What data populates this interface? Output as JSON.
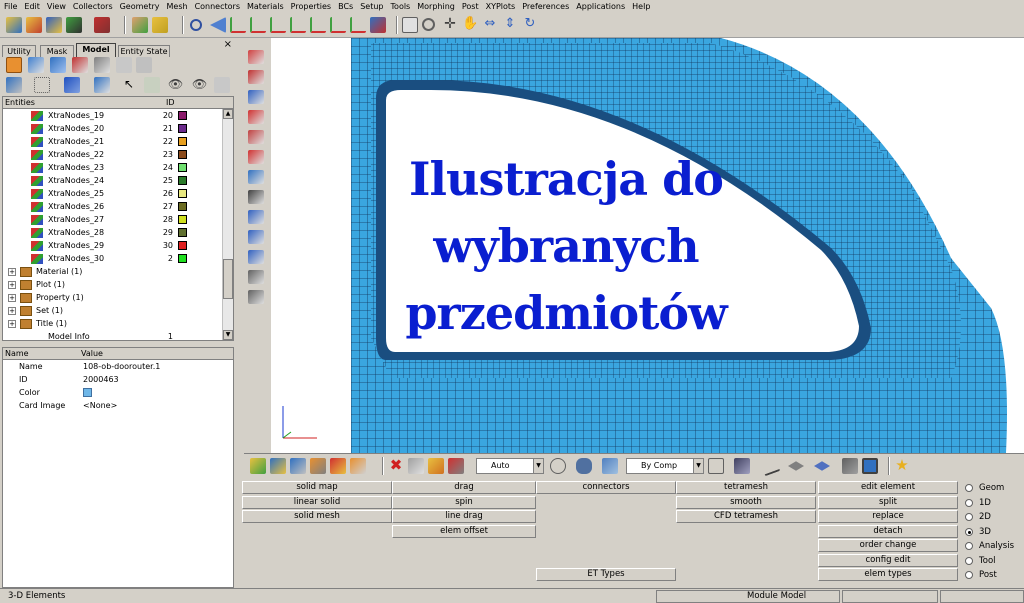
{
  "menu": [
    "File",
    "Edit",
    "View",
    "Collectors",
    "Geometry",
    "Mesh",
    "Connectors",
    "Materials",
    "Properties",
    "BCs",
    "Setup",
    "Tools",
    "Morphing",
    "Post",
    "XYPlots",
    "Preferences",
    "Applications",
    "Help"
  ],
  "tabs": [
    "Utility",
    "Mask",
    "Model",
    "Entity State"
  ],
  "active_tab": "Model",
  "tree": {
    "col_entities": "Entities",
    "col_id": "ID",
    "nodes": [
      {
        "name": "XtraNodes_19",
        "id": "20",
        "color": "#8b1a6b"
      },
      {
        "name": "XtraNodes_20",
        "id": "21",
        "color": "#6b2a8b"
      },
      {
        "name": "XtraNodes_21",
        "id": "22",
        "color": "#e8a020"
      },
      {
        "name": "XtraNodes_22",
        "id": "23",
        "color": "#8b4a1a"
      },
      {
        "name": "XtraNodes_23",
        "id": "24",
        "color": "#70e070"
      },
      {
        "name": "XtraNodes_24",
        "id": "25",
        "color": "#2a7a2a"
      },
      {
        "name": "XtraNodes_25",
        "id": "26",
        "color": "#e8e880"
      },
      {
        "name": "XtraNodes_26",
        "id": "27",
        "color": "#6a6a20"
      },
      {
        "name": "XtraNodes_27",
        "id": "28",
        "color": "#d0e020"
      },
      {
        "name": "XtraNodes_28",
        "id": "29",
        "color": "#607030"
      },
      {
        "name": "XtraNodes_29",
        "id": "30",
        "color": "#e02020"
      },
      {
        "name": "XtraNodes_30",
        "id": "2",
        "color": "#20e020"
      }
    ],
    "folders": [
      "Material (1)",
      "Plot (1)",
      "Property (1)",
      "Set (1)",
      "Title (1)"
    ],
    "partial_row": {
      "name": "Model Info",
      "id": "1"
    }
  },
  "props": {
    "col_name": "Name",
    "col_value": "Value",
    "rows": [
      {
        "name": "Name",
        "value": "108-ob-doorouter.1"
      },
      {
        "name": "ID",
        "value": "2000463"
      },
      {
        "name": "Color",
        "value": ""
      },
      {
        "name": "Card Image",
        "value": "<None>"
      }
    ],
    "color_swatch": "#6fb7e8"
  },
  "viewport": {
    "overlay_lines": [
      "Ilustracja do",
      "wybranych",
      "przedmiotów"
    ],
    "mesh_color": "#3aa6e0",
    "overlay_color": "#0a1ed0"
  },
  "combos": {
    "auto": "Auto",
    "bycomp": "By Comp"
  },
  "buttons": {
    "col1": [
      "solid map",
      "linear solid",
      "solid mesh"
    ],
    "col2": [
      "drag",
      "spin",
      "line drag",
      "elem offset"
    ],
    "col3": [
      "connectors",
      "ET Types"
    ],
    "col4": [
      "tetramesh",
      "smooth",
      "CFD tetramesh"
    ],
    "col5": [
      "edit element",
      "split",
      "replace",
      "detach",
      "order change",
      "config edit",
      "elem types"
    ]
  },
  "radios": [
    {
      "label": "Geom",
      "on": false
    },
    {
      "label": "1D",
      "on": false
    },
    {
      "label": "2D",
      "on": false
    },
    {
      "label": "3D",
      "on": true
    },
    {
      "label": "Analysis",
      "on": false
    },
    {
      "label": "Tool",
      "on": false
    },
    {
      "label": "Post",
      "on": false
    }
  ],
  "status": {
    "left": "3-D Elements",
    "module": "Module Model"
  }
}
